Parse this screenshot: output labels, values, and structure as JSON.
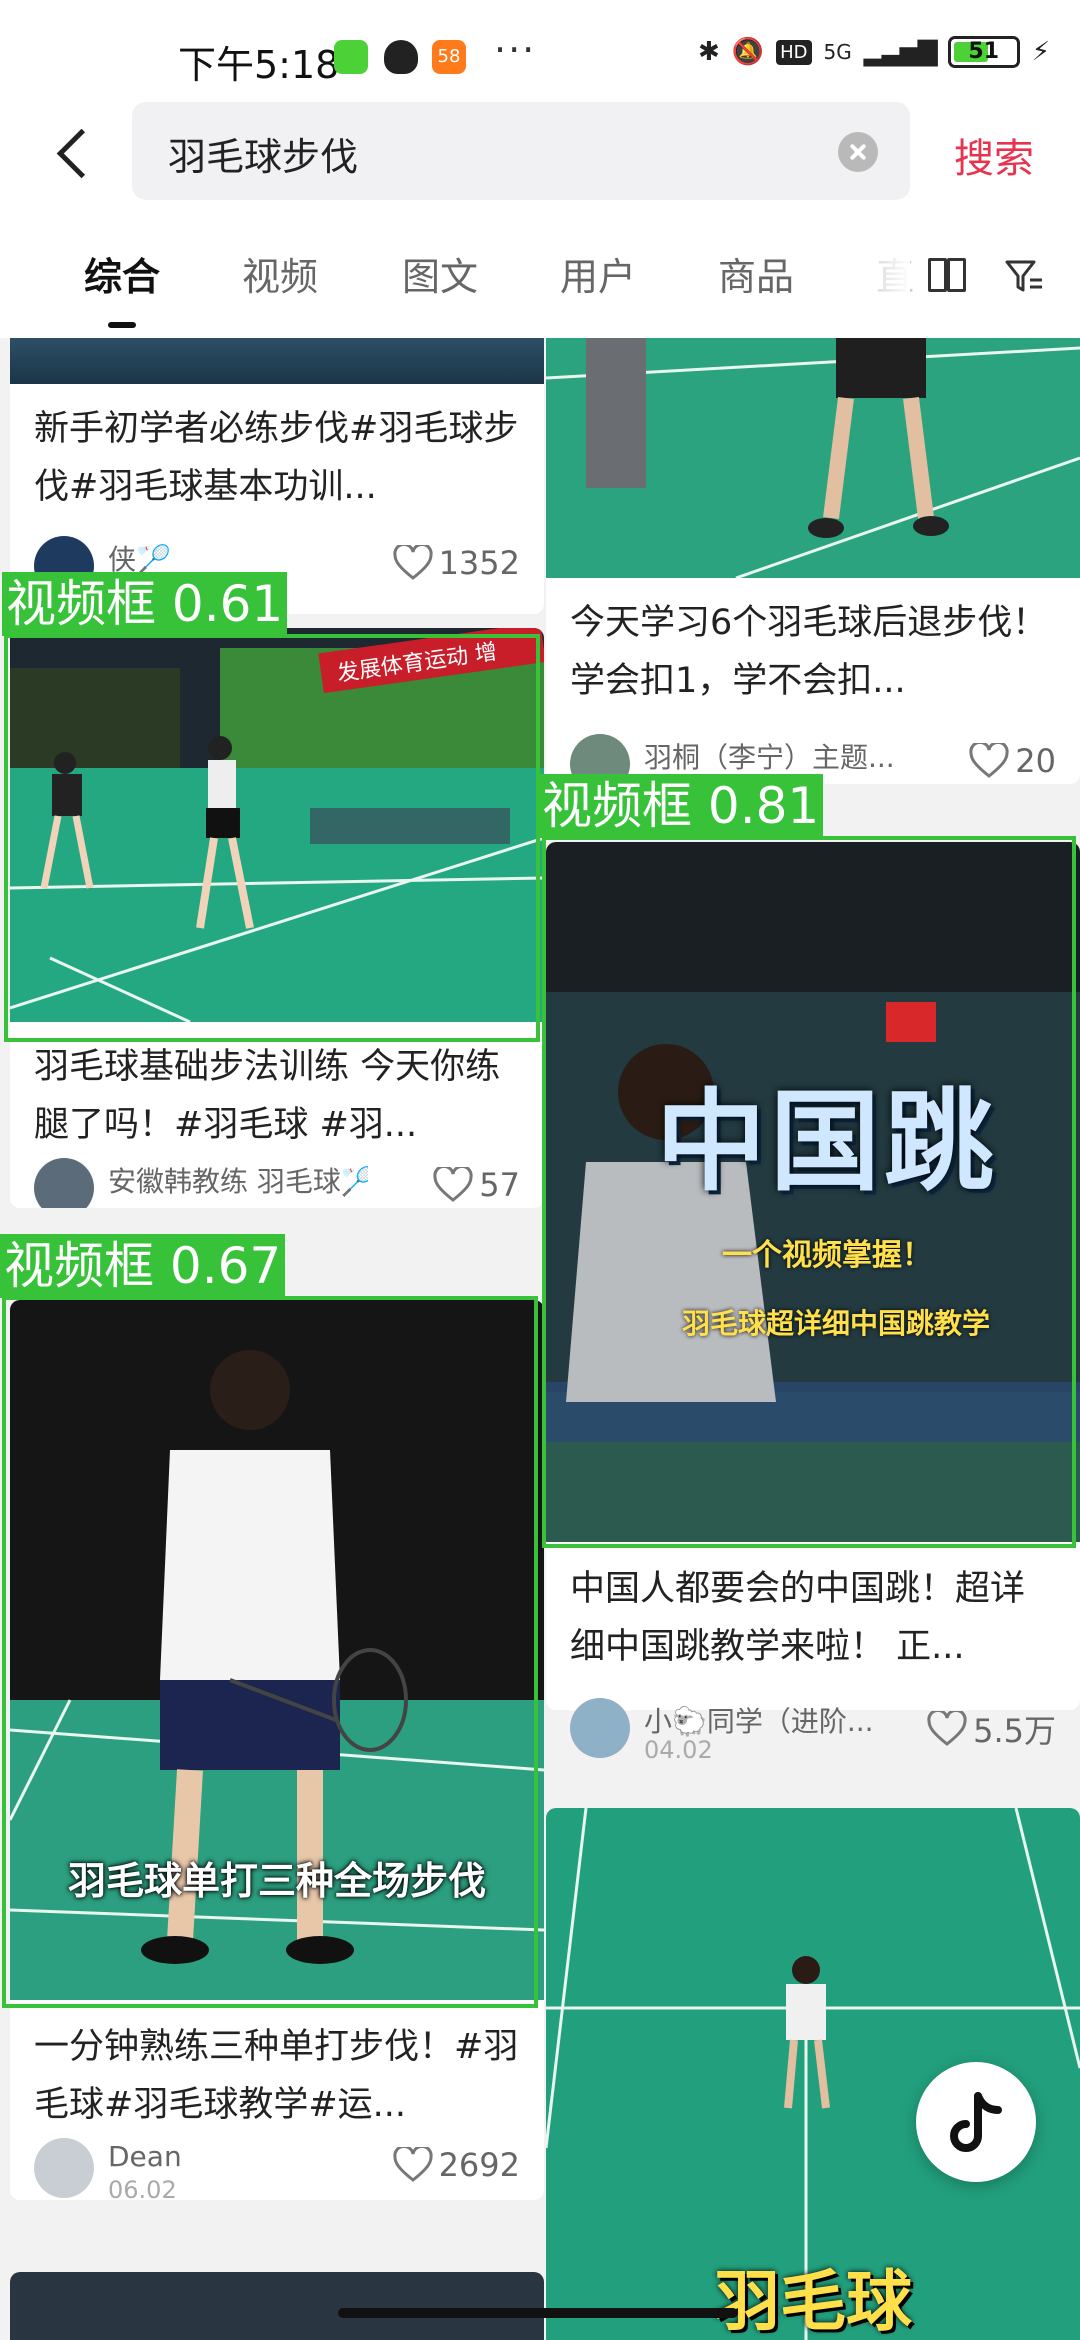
{
  "status_bar": {
    "time": "下午5:18",
    "qq_badge": "58",
    "overflow": "···",
    "network": "5G",
    "battery": "51"
  },
  "search": {
    "query": "羽毛球步伐",
    "submit_label": "搜索"
  },
  "tabs": [
    {
      "label": "综合",
      "active": true
    },
    {
      "label": "视频",
      "active": false
    },
    {
      "label": "图文",
      "active": false
    },
    {
      "label": "用户",
      "active": false
    },
    {
      "label": "商品",
      "active": false
    },
    {
      "label": "直",
      "active": false
    }
  ],
  "feed": {
    "left": [
      {
        "title": "新手初学者必练步伐#羽毛球步伐#羽毛球基本功训...",
        "author": "侠🏸",
        "likes": "1352"
      },
      {
        "title": "羽毛球基础步法训练 今天你练腿了吗！#羽毛球 #羽...",
        "author": "安徽韩教练 羽毛球🏸",
        "likes": "57"
      },
      {
        "title": "一分钟熟练三种单打步伐！#羽毛球#羽毛球教学#运...",
        "author": "Dean",
        "date": "06.02",
        "likes": "2692",
        "overlay_text": "羽毛球单打三种全场步伐"
      }
    ],
    "right": [
      {
        "title": "今天学习6个羽毛球后退步伐！学会扣1，学不会扣...",
        "author": "羽桐（李宁）主题...",
        "likes": "20"
      },
      {
        "title": "中国人都要会的中国跳！超详细中国跳教学来啦！ 正...",
        "author": "小🐑同学（进阶...",
        "date": "04.02",
        "likes": "5.5万",
        "overlay_big": "中国跳",
        "overlay_sub1": "一个视频掌握！",
        "overlay_sub2": "羽毛球超详细中国跳教学"
      },
      {
        "overlay_text": "羽毛球"
      }
    ]
  },
  "detections": [
    {
      "label": "视频框 0.61"
    },
    {
      "label": "视频框 0.81"
    },
    {
      "label": "视频框 0.67"
    }
  ],
  "gym_banner": "发展体育运动 增",
  "colors": {
    "accent": "#e8334f",
    "detect": "#37c23a",
    "court": "#1f9e78"
  }
}
